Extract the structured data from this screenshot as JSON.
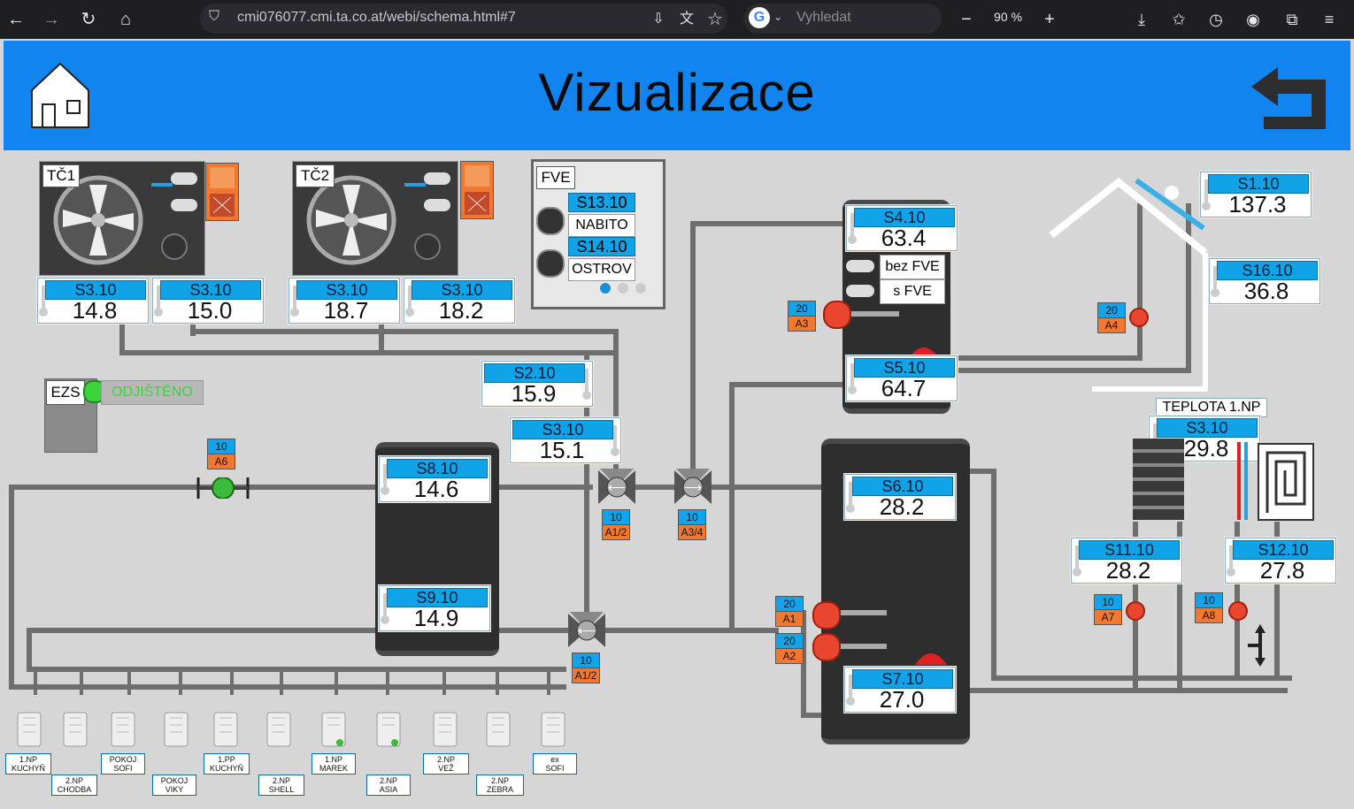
{
  "browser": {
    "url": "cmi076077.cmi.ta.co.at/webi/schema.html#7",
    "search_placeholder": "Vyhledat",
    "zoom": "90 %"
  },
  "header": {
    "title": "Vizualizace"
  },
  "heatpumps": [
    {
      "name": "TČ1",
      "sensors": [
        {
          "label": "S3.10",
          "value": "14.8"
        },
        {
          "label": "S3.10",
          "value": "15.0"
        }
      ]
    },
    {
      "name": "TČ2",
      "sensors": [
        {
          "label": "S3.10",
          "value": "18.7"
        },
        {
          "label": "S3.10",
          "value": "18.2"
        }
      ]
    }
  ],
  "fve": {
    "name": "FVE",
    "rows": [
      {
        "label": "S13.10",
        "status": "NABITO"
      },
      {
        "label": "S14.10",
        "status": "OSTROV"
      }
    ]
  },
  "ezs": {
    "name": "EZS",
    "status": "ODJIŠTĚNO"
  },
  "sensors": {
    "s1": {
      "label": "S1.10",
      "value": "137.3"
    },
    "s16": {
      "label": "S16.10",
      "value": "36.8"
    },
    "s4": {
      "label": "S4.10",
      "value": "63.4"
    },
    "s5": {
      "label": "S5.10",
      "value": "64.7"
    },
    "s2": {
      "label": "S2.10",
      "value": "15.9"
    },
    "s3": {
      "label": "S3.10",
      "value": "15.1"
    },
    "s8": {
      "label": "S8.10",
      "value": "14.6"
    },
    "s9": {
      "label": "S9.10",
      "value": "14.9"
    },
    "s6": {
      "label": "S6.10",
      "value": "28.2"
    },
    "s7": {
      "label": "S7.10",
      "value": "27.0"
    },
    "floor": {
      "caption": "TEPLOTA 1.NP",
      "label": "S3.10",
      "value": "29.8"
    },
    "s11": {
      "label": "S11.10",
      "value": "28.2"
    },
    "s12": {
      "label": "S12.10",
      "value": "27.8"
    }
  },
  "boiler_modes": [
    "bez FVE",
    "s FVE"
  ],
  "tags": {
    "a3": {
      "num": "20",
      "out": "A3"
    },
    "a4": {
      "num": "20",
      "out": "A4"
    },
    "a6": {
      "num": "10",
      "out": "A6"
    },
    "a12a": {
      "num": "10",
      "out": "A1/2"
    },
    "a34": {
      "num": "10",
      "out": "A3/4"
    },
    "a12b": {
      "num": "10",
      "out": "A1/2"
    },
    "a1": {
      "num": "20",
      "out": "A1"
    },
    "a2": {
      "num": "20",
      "out": "A2"
    },
    "a7": {
      "num": "10",
      "out": "A7"
    },
    "a8": {
      "num": "10",
      "out": "A8"
    }
  },
  "radiators": [
    {
      "l1": "1.NP",
      "l2": "KUCHYŇ"
    },
    {
      "l1": "2.NP",
      "l2": "CHODBA"
    },
    {
      "l1": "POKOJ",
      "l2": "SOFI"
    },
    {
      "l1": "POKOJ",
      "l2": "VIKY"
    },
    {
      "l1": "1.PP",
      "l2": "KUCHYŇ"
    },
    {
      "l1": "2.NP",
      "l2": "SHELL"
    },
    {
      "l1": "1.NP",
      "l2": "MAREK"
    },
    {
      "l1": "2.NP",
      "l2": "ASIA"
    },
    {
      "l1": "2.NP",
      "l2": "VEŽ"
    },
    {
      "l1": "2.NP",
      "l2": "ZEBRA"
    },
    {
      "l1": "ex",
      "l2": "SOFI"
    }
  ],
  "colors": {
    "header": "#1284f0",
    "sensor_label": "#11a3e8",
    "tag_out": "#f07830",
    "pump": "#e8462e",
    "ezs_ok": "#3bd43b"
  }
}
